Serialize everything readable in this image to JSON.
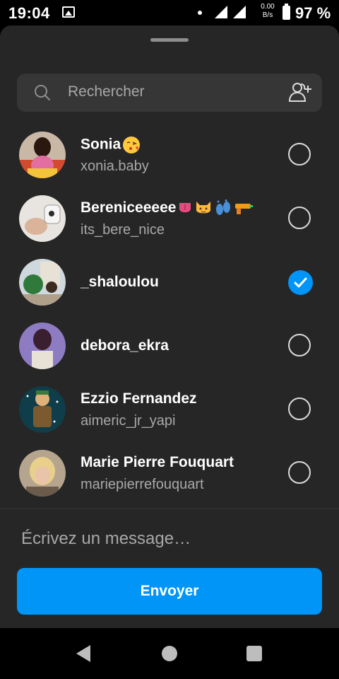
{
  "status_bar": {
    "time": "19:04",
    "net_speed_value": "0.00",
    "net_speed_unit": "B/s",
    "battery": "97 %"
  },
  "search": {
    "placeholder": "Rechercher"
  },
  "contacts": [
    {
      "name": "Sonia",
      "name_emojis": [
        "face-blowing-kiss"
      ],
      "username": "xonia.baby",
      "selected": false
    },
    {
      "name": "Berenicee​eee",
      "name_emojis": [
        "tongue",
        "cat-face",
        "footprints",
        "water-pistol"
      ],
      "username": "its_bere_nice",
      "selected": false
    },
    {
      "name": "_shaloulou",
      "name_emojis": [],
      "username": "",
      "selected": true
    },
    {
      "name": "debora_ekra",
      "name_emojis": [],
      "username": "",
      "selected": false
    },
    {
      "name": "Ezzio Fernandez",
      "name_emojis": [],
      "username": "aimeric_jr_yapi",
      "selected": false
    },
    {
      "name": "Marie Pierre Fouquart",
      "name_emojis": [],
      "username": "mariepierrefouquart",
      "selected": false
    }
  ],
  "composer": {
    "placeholder": "Écrivez un message…",
    "send_label": "Envoyer"
  },
  "colors": {
    "accent": "#0095f6",
    "sheet_background": "#262626",
    "secondary_text": "#a8a8a8"
  }
}
